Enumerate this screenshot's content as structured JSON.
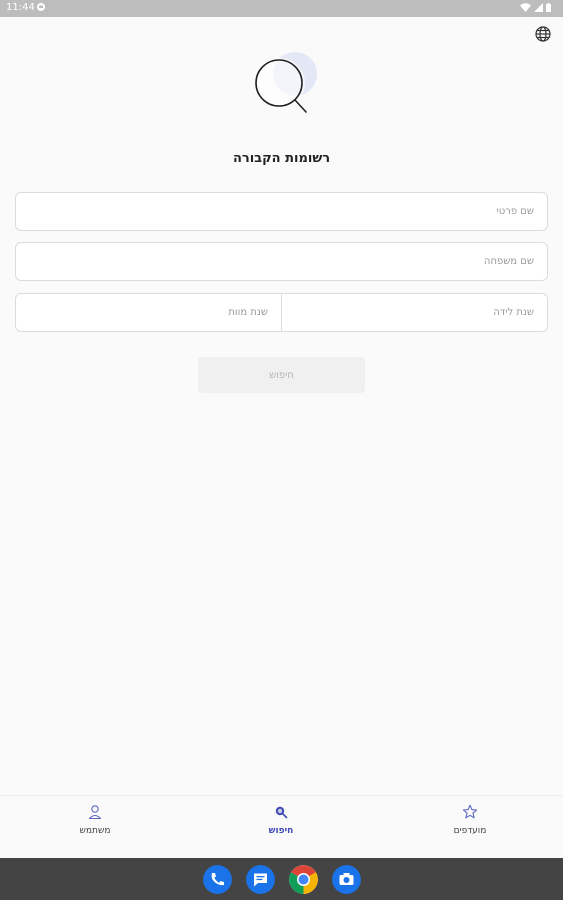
{
  "status_bar": {
    "time": "11:44"
  },
  "header": {
    "language_icon": "globe-icon"
  },
  "page": {
    "title": "רשומות הקבורה"
  },
  "form": {
    "first_name_placeholder": "שם פרטי",
    "last_name_placeholder": "שם משפחה",
    "birth_year_placeholder": "שנת לידה",
    "death_year_placeholder": "שנת מוות",
    "search_label": "חיפוש"
  },
  "bottom_nav": {
    "items": [
      {
        "label": "מועדפים",
        "icon": "star-icon"
      },
      {
        "label": "חיפוש",
        "icon": "search-icon",
        "active": true
      },
      {
        "label": "משתמש",
        "icon": "user-icon"
      }
    ]
  },
  "dock": {
    "apps": [
      "phone-icon",
      "messages-icon",
      "chrome-icon",
      "camera-icon"
    ]
  },
  "colors": {
    "accent": "#3f4bb5",
    "hero_circle": "#e4e7f5",
    "disabled_button": "#f0f0f0"
  }
}
